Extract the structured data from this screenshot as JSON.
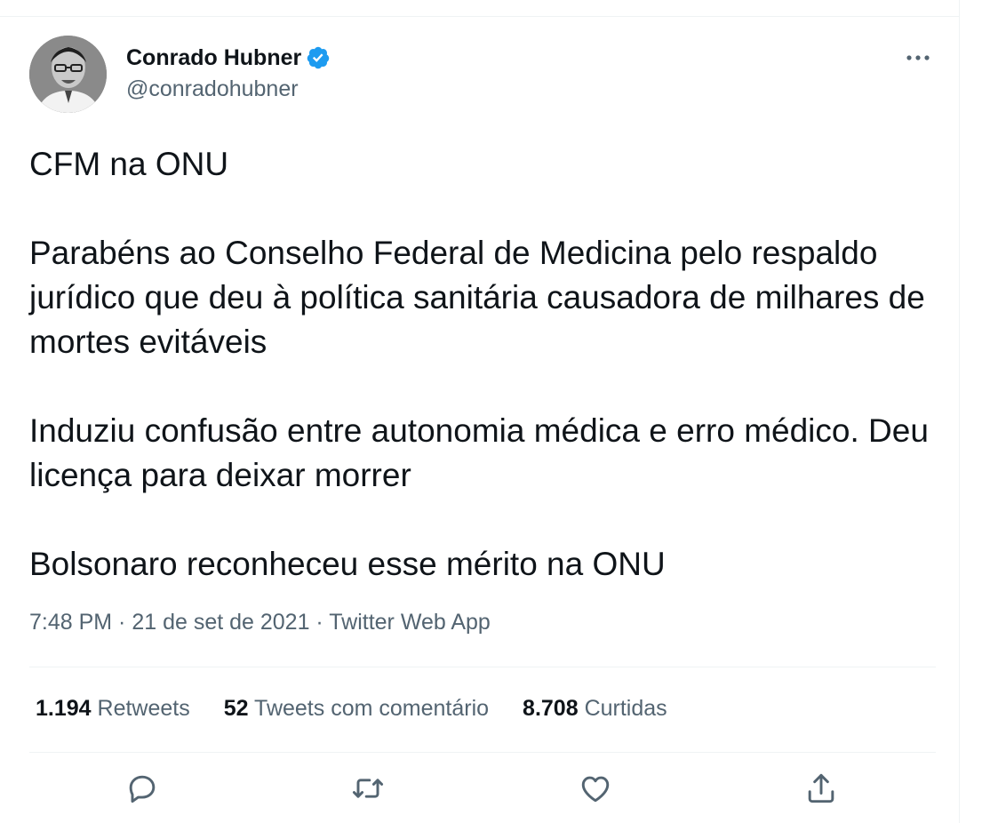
{
  "tweet": {
    "author": {
      "name": "Conrado Hubner",
      "handle": "@conradohubner"
    },
    "paragraphs": [
      "CFM na ONU",
      "Parabéns ao Conselho Federal de Medicina pelo respaldo jurídico que deu à política sanitária causadora de milhares de mortes evitáveis",
      "Induziu confusão entre autonomia médica e erro médico. Deu licença para deixar morrer",
      "Bolsonaro reconheceu esse mérito na ONU"
    ],
    "meta": "7:48 PM · 21 de set de 2021 · Twitter Web App",
    "stats": {
      "retweets_count": "1.194",
      "retweets_label": "Retweets",
      "quotes_count": "52",
      "quotes_label": "Tweets com comentário",
      "likes_count": "8.708",
      "likes_label": "Curtidas"
    }
  },
  "icons": {
    "more": "more-icon",
    "verified": "verified-badge-icon",
    "reply": "reply-icon",
    "retweet": "retweet-icon",
    "like": "like-icon",
    "share": "share-icon"
  },
  "colors": {
    "verified": "#1d9bf0",
    "secondary_text": "#536471",
    "primary_text": "#0f1419",
    "divider": "#eff3f4"
  }
}
